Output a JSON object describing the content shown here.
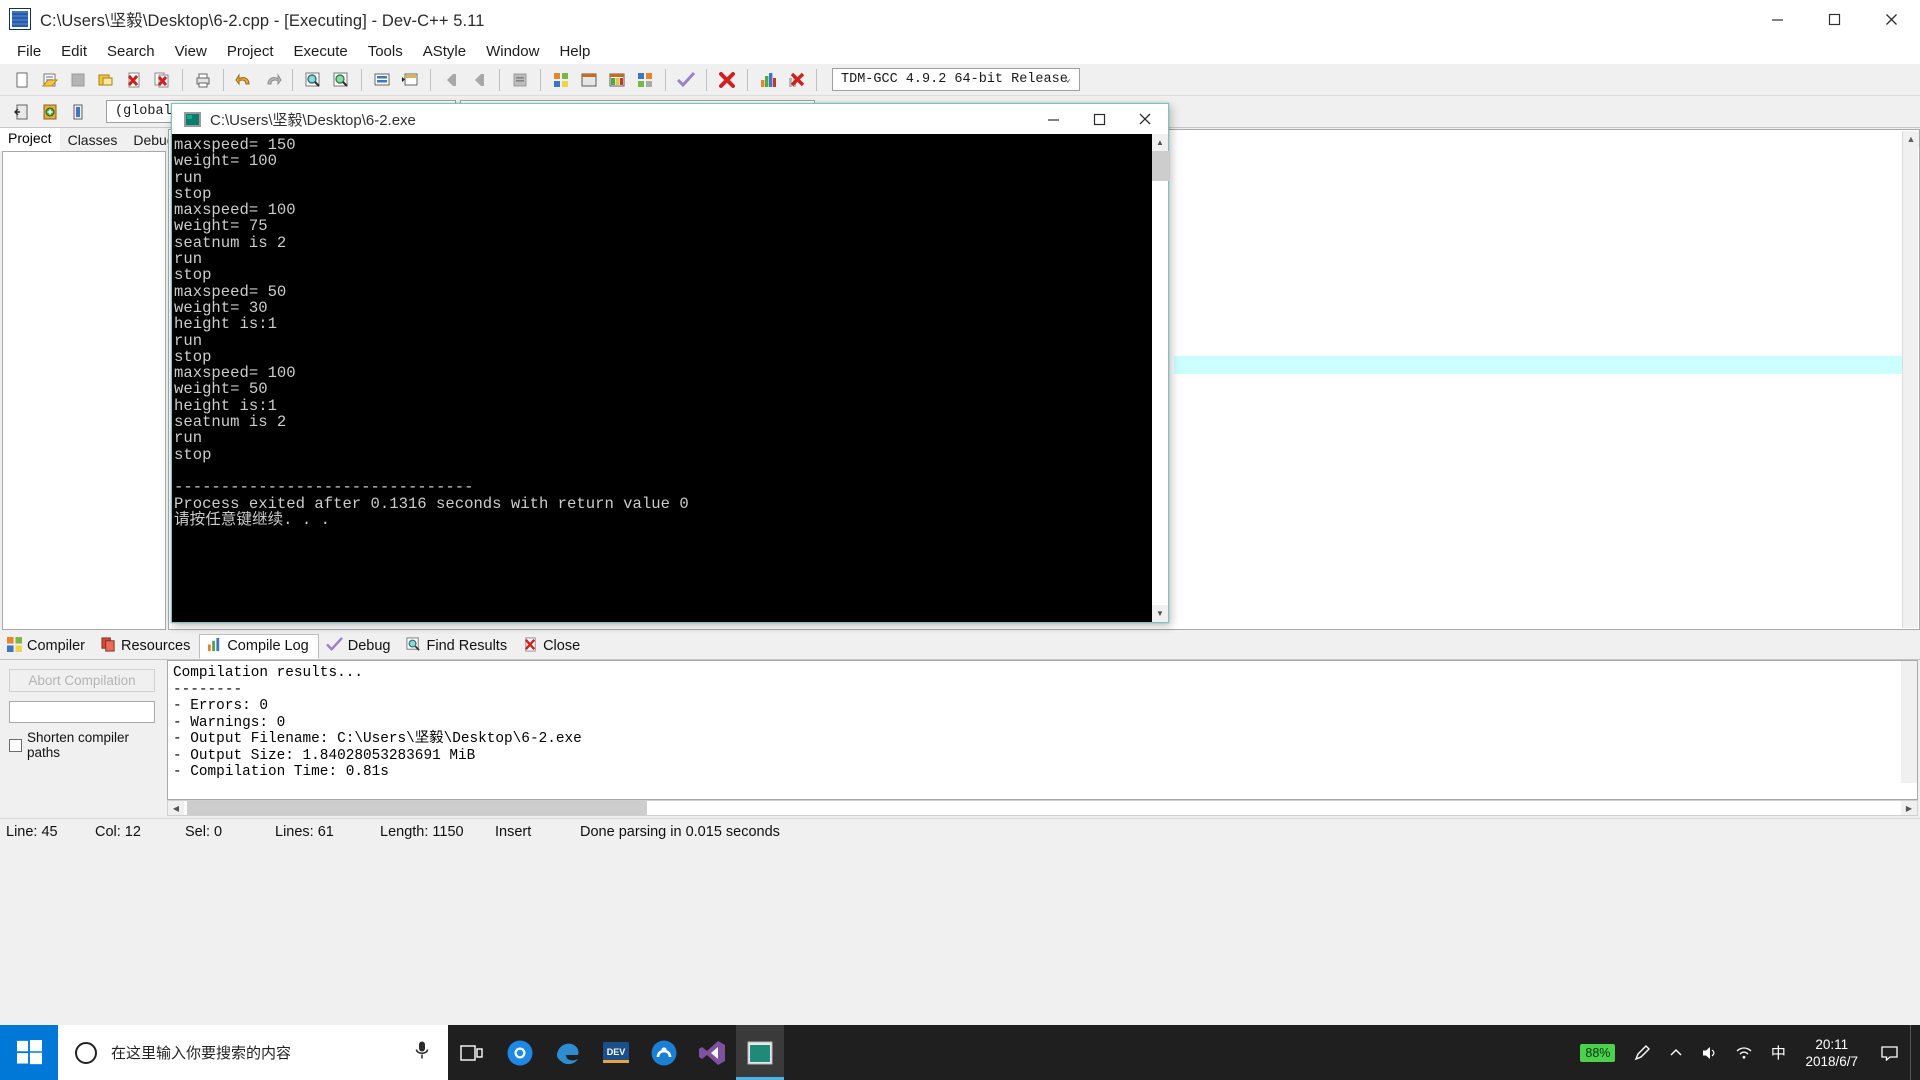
{
  "window": {
    "title": "C:\\Users\\坚毅\\Desktop\\6-2.cpp - [Executing] - Dev-C++ 5.11",
    "minimize": "–",
    "maximize": "□",
    "close": "✕"
  },
  "menu": {
    "items": [
      {
        "label": "File"
      },
      {
        "label": "Edit"
      },
      {
        "label": "Search"
      },
      {
        "label": "View"
      },
      {
        "label": "Project"
      },
      {
        "label": "Execute"
      },
      {
        "label": "Tools"
      },
      {
        "label": "AStyle"
      },
      {
        "label": "Window"
      },
      {
        "label": "Help"
      }
    ]
  },
  "toolbar": {
    "compiler_combo_value": "TDM-GCC 4.9.2 64-bit Release",
    "globals_combo_value": "(globals)",
    "blank_combo_value": "",
    "caret": "⌄",
    "icons_row1": [
      "new-file-icon",
      "open-file-icon",
      "save-icon",
      "save-all-icon",
      "close-file-icon",
      "close-all-icon",
      "print-icon",
      "undo-icon",
      "redo-icon",
      "find-icon",
      "replace-icon",
      "goto-line-icon",
      "goto-function-icon",
      "back-icon",
      "forward-icon",
      "toggle-breakpoint-icon",
      "compile-icon",
      "run-icon",
      "compile-and-run-icon",
      "rebuild-all-icon",
      "syntax-check-icon",
      "stop-execution-icon",
      "profiling-icon",
      "delete-profiling-icon"
    ],
    "icons_row2": [
      "insert-icon",
      "toggle-icon",
      "goto-icon"
    ]
  },
  "left_panel": {
    "tabs": [
      {
        "label": "Project",
        "active": true
      },
      {
        "label": "Classes",
        "active": false
      },
      {
        "label": "Debug",
        "active": false
      }
    ]
  },
  "console": {
    "title": "C:\\Users\\坚毅\\Desktop\\6-2.exe",
    "minimize": "–",
    "maximize": "□",
    "close": "✕",
    "output": "maxspeed= 150\nweight= 100\nrun\nstop\nmaxspeed= 100\nweight= 75\nseatnum is 2\nrun\nstop\nmaxspeed= 50\nweight= 30\nheight is:1\nrun\nstop\nmaxspeed= 100\nweight= 50\nheight is:1\nseatnum is 2\nrun\nstop\n\n--------------------------------\nProcess exited after 0.1316 seconds with return value 0\n请按任意键继续. . ."
  },
  "bottom_tabs": [
    {
      "label": "Compiler",
      "icon": "compiler-icon",
      "active": false
    },
    {
      "label": "Resources",
      "icon": "resources-icon",
      "active": false
    },
    {
      "label": "Compile Log",
      "icon": "compile-log-icon",
      "active": true
    },
    {
      "label": "Debug",
      "icon": "debug-check-icon",
      "active": false
    },
    {
      "label": "Find Results",
      "icon": "find-results-icon",
      "active": false
    },
    {
      "label": "Close",
      "icon": "close-panel-icon",
      "active": false
    }
  ],
  "compile_panel": {
    "abort_label": "Abort Compilation",
    "shorten_label": "Shorten compiler paths",
    "log": "Compilation results...\n--------\n- Errors: 0\n- Warnings: 0\n- Output Filename: C:\\Users\\坚毅\\Desktop\\6-2.exe\n- Output Size: 1.84028053283691 MiB\n- Compilation Time: 0.81s"
  },
  "statusbar": {
    "line_key": "Line:",
    "line_value": "45",
    "col_key": "Col:",
    "col_value": "12",
    "sel_key": "Sel:",
    "sel_value": "0",
    "lines_key": "Lines:",
    "lines_value": "61",
    "length_key": "Length:",
    "length_value": "1150",
    "mode": "Insert",
    "parse_status": "Done parsing in 0.015 seconds"
  },
  "taskbar": {
    "start_icon": "windows-start-icon",
    "search_placeholder": "在这里输入你要搜索的内容",
    "mic_icon": "microphone-icon",
    "taskview_icon": "task-view-icon",
    "apps": [
      {
        "name": "chrome-like-icon",
        "active": false
      },
      {
        "name": "edge-icon",
        "active": false
      },
      {
        "name": "devcpp-icon",
        "active": false
      },
      {
        "name": "qq-browser-icon",
        "active": false
      },
      {
        "name": "visual-studio-icon",
        "active": false
      },
      {
        "name": "console-window-icon",
        "active": true
      }
    ],
    "battery_percent": "88%",
    "pen_icon": "pen-icon",
    "chevron_up_icon": "chevron-up-icon",
    "volume_icon": "volume-icon",
    "network_icon": "network-icon",
    "ime_icon": "中",
    "time": "20:11",
    "date": "2018/6/7",
    "notification_icon": "notification-icon"
  },
  "colors": {
    "accent": "#0078d7",
    "taskbar_bg": "#1f1f1f",
    "console_bg": "#000000",
    "console_fg": "#cccccc",
    "battery_green": "#4bd14b",
    "editor_highlight": "#ccffff"
  }
}
